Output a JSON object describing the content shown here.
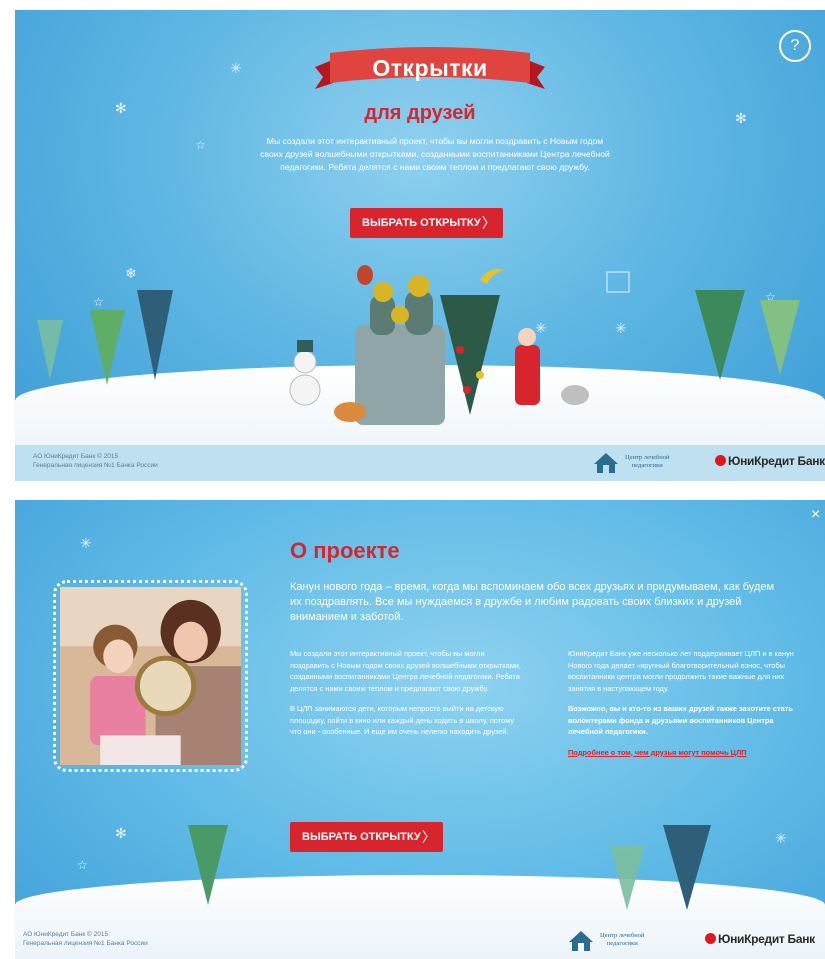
{
  "screen1": {
    "title": "Открытки",
    "subtitle": "для друзей",
    "intro": "Мы создали этот интерактивный проект, чтобы вы могли поздравить с Новым годом своих друзей волшебными открытками, созданными воспитанниками Центра лечебной педагогики. Ребята делятся с нами своим теплом и предлагают свою дружбу.",
    "cta_label": "ВЫБРАТЬ ОТКРЫТКУ",
    "help_label": "?",
    "chevron": "〉"
  },
  "screen2": {
    "close_label": "×",
    "heading": "О проекте",
    "lead": "Канун нового года – время, когда мы вспоминаем обо всех друзьях и придумываем, как будем их поздравлять. Все мы нуждаемся в дружбе и любим радовать своих близких и друзей вниманием и заботой.",
    "left_col": [
      "Мы создали этот интерактивный проект, чтобы вы могли поздравить с Новым годом своих друзей волшебными открытками, созданными воспитанниками Центра лечебной педагогики. Ребята делятся с нами своим теплом и предлагают свою дружбу.",
      "В ЦЛП занимаются дети, которым непросто выйти на детскую площадку, пойти в кино или каждый день ходить в школу, потому что они - особенные. И еще им очень нелегко находить друзей."
    ],
    "right_col": [
      "ЮниКредит Банк уже несколько лет поддерживает ЦЛП и в канун Нового года делает «крупный благотворительный взнос, чтобы воспитанники центра могли продолжить такие важные для них занятия в наступающем году.",
      "Возможно, вы и кто-то из ваших друзей также захотите стать волонтерами фонда и друзьями воспитанников Центра лечебной педагогики."
    ],
    "link": "Подробнее о том, чем друзья могут помочь ЦЛП",
    "cta_label": "ВЫБРАТЬ ОТКРЫТКУ",
    "chevron": "〉"
  },
  "footer": {
    "legal_line1": "АО ЮниКредит Банк © 2015",
    "legal_line2": "Генеральная лицензия №1 Банка России",
    "clp_line1": "Центр лечебной",
    "clp_line2": "педагогики",
    "bank": "ЮниКредит Банк"
  },
  "colors": {
    "accent_red": "#d8252d",
    "sky": "#5fb7e3",
    "footer_bg": "#bfe0f1"
  },
  "icons": [
    "snowflake-icon",
    "star-icon",
    "help-icon",
    "close-icon",
    "chevron-right-icon",
    "clp-house-icon",
    "unicredit-mark-icon"
  ]
}
